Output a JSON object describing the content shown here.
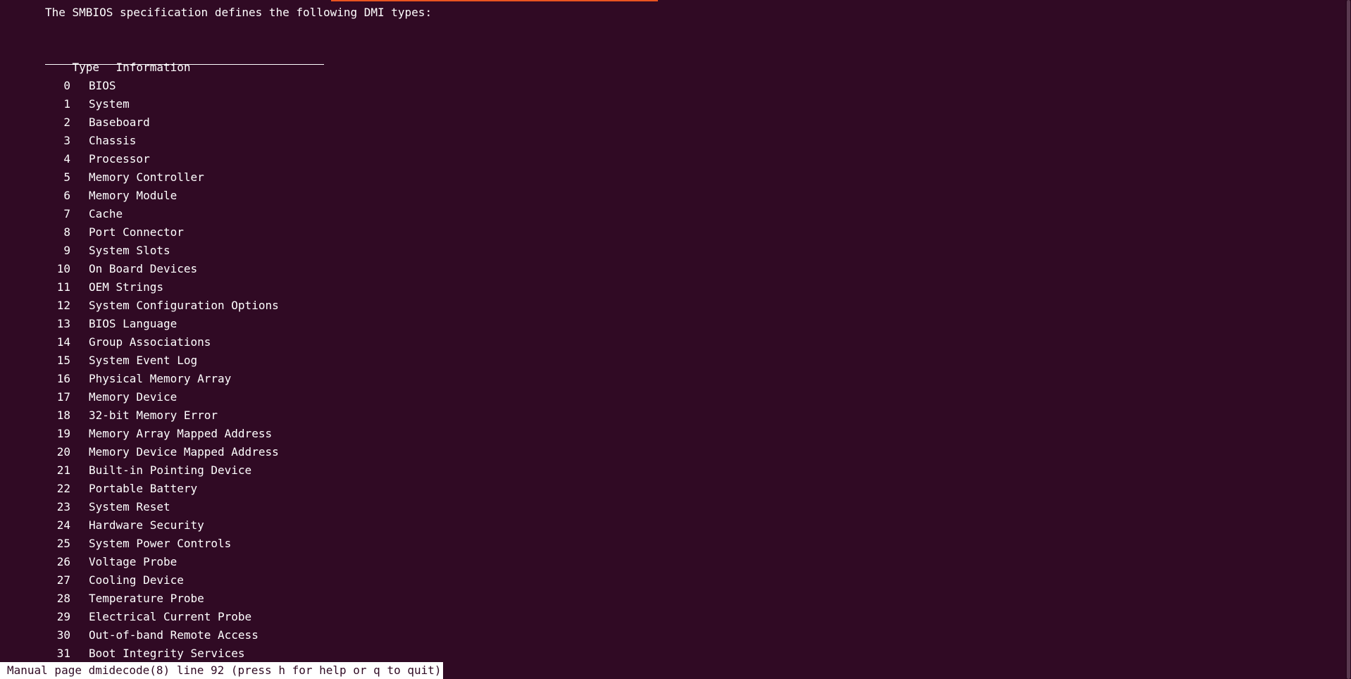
{
  "terminal": {
    "intro": "The SMBIOS specification defines the following DMI types:",
    "header": {
      "type": "Type",
      "info": "Information"
    },
    "rows": [
      {
        "num": "0",
        "label": "BIOS"
      },
      {
        "num": "1",
        "label": "System"
      },
      {
        "num": "2",
        "label": "Baseboard"
      },
      {
        "num": "3",
        "label": "Chassis"
      },
      {
        "num": "4",
        "label": "Processor"
      },
      {
        "num": "5",
        "label": "Memory Controller"
      },
      {
        "num": "6",
        "label": "Memory Module"
      },
      {
        "num": "7",
        "label": "Cache"
      },
      {
        "num": "8",
        "label": "Port Connector"
      },
      {
        "num": "9",
        "label": "System Slots"
      },
      {
        "num": "10",
        "label": "On Board Devices"
      },
      {
        "num": "11",
        "label": "OEM Strings"
      },
      {
        "num": "12",
        "label": "System Configuration Options"
      },
      {
        "num": "13",
        "label": "BIOS Language"
      },
      {
        "num": "14",
        "label": "Group Associations"
      },
      {
        "num": "15",
        "label": "System Event Log"
      },
      {
        "num": "16",
        "label": "Physical Memory Array"
      },
      {
        "num": "17",
        "label": "Memory Device"
      },
      {
        "num": "18",
        "label": "32-bit Memory Error"
      },
      {
        "num": "19",
        "label": "Memory Array Mapped Address"
      },
      {
        "num": "20",
        "label": "Memory Device Mapped Address"
      },
      {
        "num": "21",
        "label": "Built-in Pointing Device"
      },
      {
        "num": "22",
        "label": "Portable Battery"
      },
      {
        "num": "23",
        "label": "System Reset"
      },
      {
        "num": "24",
        "label": "Hardware Security"
      },
      {
        "num": "25",
        "label": "System Power Controls"
      },
      {
        "num": "26",
        "label": "Voltage Probe"
      },
      {
        "num": "27",
        "label": "Cooling Device"
      },
      {
        "num": "28",
        "label": "Temperature Probe"
      },
      {
        "num": "29",
        "label": "Electrical Current Probe"
      },
      {
        "num": "30",
        "label": "Out-of-band Remote Access"
      },
      {
        "num": "31",
        "label": "Boot Integrity Services"
      }
    ],
    "status": "Manual page dmidecode(8) line 92 (press h for help or q to quit)"
  },
  "colors": {
    "background": "#300a24",
    "text": "#ffffff",
    "accent": "#e95420"
  }
}
